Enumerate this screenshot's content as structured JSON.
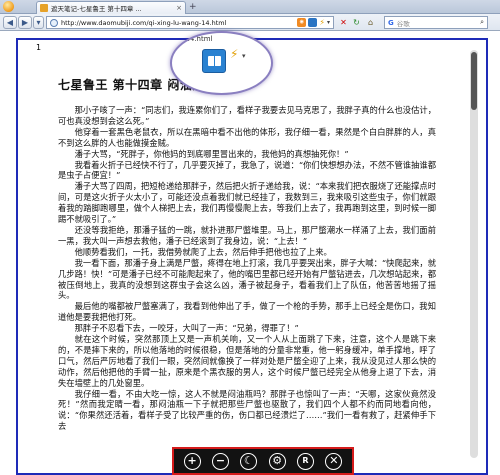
{
  "browser": {
    "tab_title": "遮天笔记-七星鲁王 第十四章 ...",
    "new_tab": "+",
    "url": "http://www.daomubiji.com/qi-xing-lu-wang-14.html",
    "search_placeholder": "谷歌",
    "search_engine": "G"
  },
  "lens": {
    "url_fragment": "ng-14.html"
  },
  "reader": {
    "page_number": "1",
    "heading": "七星鲁王 第十四章 闷油瓶",
    "paragraphs": [
      "那小子咳了一声：“同志们，我连累你们了，看样子我要去见马克思了，我胖子真的什么也没估计，可也真没想到会这么死。”",
      "他穿着一套黑色老鼠衣，所以在黑暗中看不出他的体形，我仔细一看，果然是个白白胖胖的人，真不到这么胖的人也能做摸金贼。",
      "潘子大骂，“死胖子，你他妈的到底哪里冒出来的，我他妈的真想抽死你！”",
      "我看着火折子已经快不行了，几乎要灭掉了，我急了，说道：“你们快想想办法，不然不管谁抽谁都是虫子占便宜！”",
      "潘子大骂了四周，把短枪递给那胖子，然后把火折子递给我，说：“本来我们把衣服烧了还能撑点时间，可是这火折子火太小了，可能还没点着我们就已经挂了，我数到三，我来吸引这些虫子，你们就跟着我的踏脚跑哪里，做个人梯把上去，我们再慢慢爬上去，等我们上去了，我再跑到这里，到时候一脚踢不就吸引了。”",
      "还没等我拒绝，那潘子猛的一跳，就扑进那尸蟞堆里。马上，那尸蟞潮水一样涌了上去，我们面前一黑，我大叫一声想去救他，潘子已经滚到了我身边，说：“上去！”",
      "他顺势看我们，一托，我借势就爬了上去，然后伸手把他也拉了上来。",
      "我一看下面，那潘子身上满是尸蟞，疼得在地上打滚，我几乎要哭出来，胖子大喊：“快爬起来，就几步路！快！”可是潘子已经不可能爬起来了，他的嘴巴里都已经开始有尸蟞钻进去，几次想站起来，都被压倒地上，我真的没想到这群虫子会这么凶，潘子被起身子，看着我们上了队伍，他苦苦地摇了摇头。",
      "最后他的嘴都被尸蟞塞满了，我看到他伸出了手，做了一个枪的手势，那手上已经全是伤口，我知道他是要我把他打死。",
      "那胖子不忍看下去，一咬牙，大叫了一声：“兄弟，得罪了！”",
      "就在这个时候，突然那顶上又是一声机关响，又一个人从上面跳了下来，注意，这个人是跳下来的，不是摔下来的，所以他落地的时候很稳，但是落地的分量非常重，他一躬身缓冲，单手撑地，呼了口气，然后严厉地看了我们一眼，突然间就像换了一样对处是尸蟞全迎了上来，我从没见过人那么快的动作，然后他把他的手臂一扯，原来是个黑衣服的男人，这个时候尸蟞已经完全从他身上退了下去，消失在墙壁上的几处窗里。",
      "我仔细一看，不由大吃一惊，这人不就是闷油瓶吗？那胖子也惊叫了一声：“天哪，这家伙竟然没死！”然而我定睛一看，那闷油瓶一下子就把那些尸蟞也驱散了，我们四个人都不约而同地看向他，说：“你果然还活着，看样子受了比较严重的伤，伤口都已经溃烂了……”我们一看有救了，赶紧伸手下去",
      "有救了，赶紧伸手下去"
    ]
  },
  "toolbar": {
    "zoom_in": "+",
    "zoom_out": "−",
    "night_mode": "☾",
    "settings": "⚙",
    "font": "R",
    "close": "✕"
  },
  "colors": {
    "viewport_border": "#1e2bb8",
    "toolbar_border": "#d51b1b",
    "toolbar_bg": "#121212"
  }
}
